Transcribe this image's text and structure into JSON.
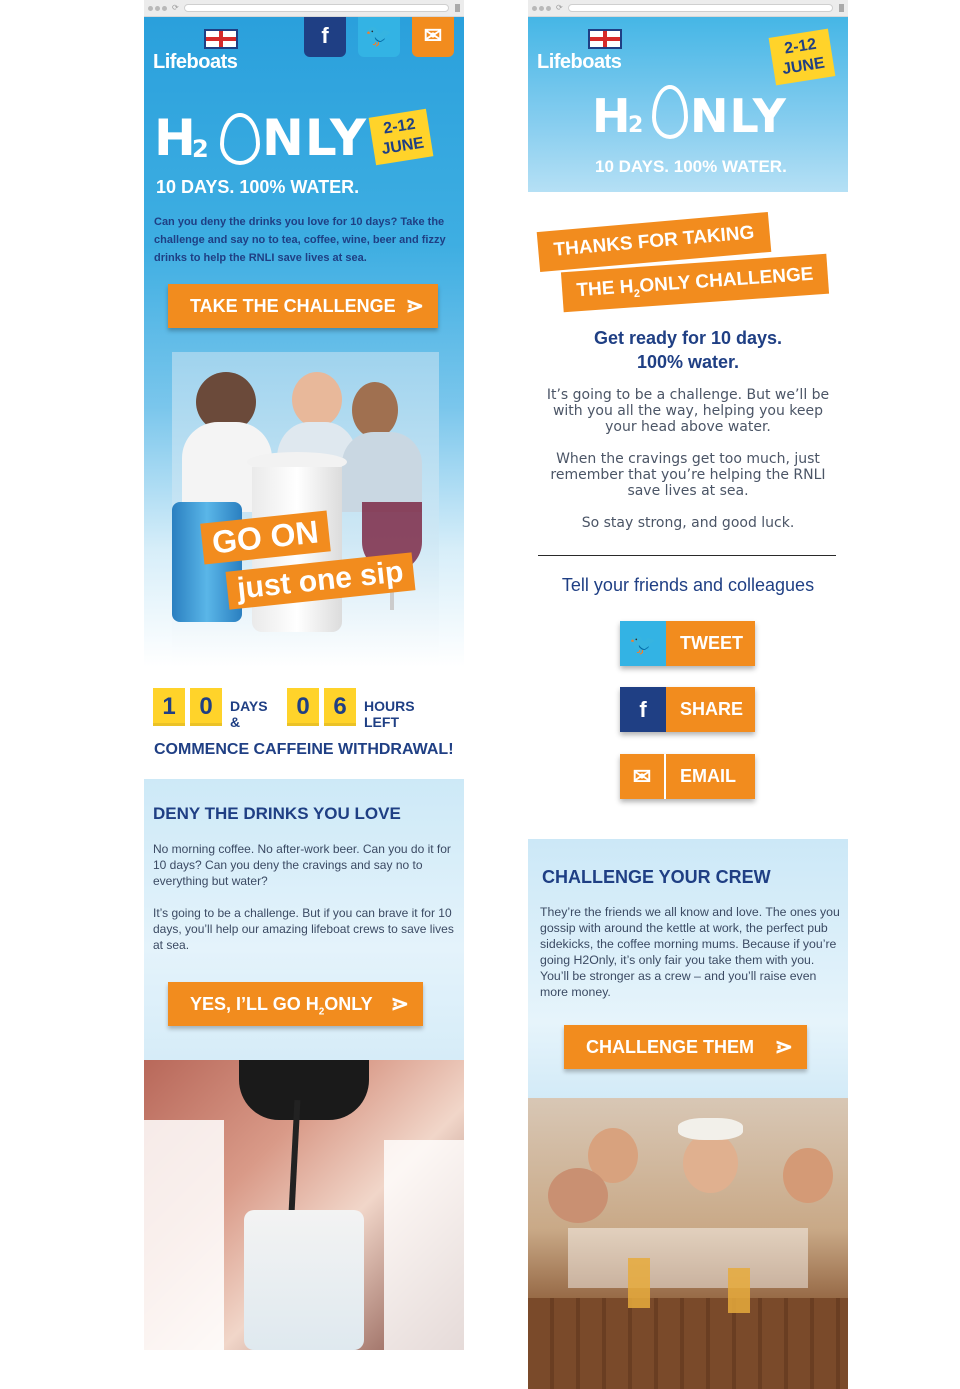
{
  "brand": {
    "name": "Lifeboats"
  },
  "campaign": {
    "title_h": "H",
    "title_2": "2",
    "title_rest": "NLY",
    "date_line1": "2-12",
    "date_line2": "JUNE",
    "tagline": "10 DAYS. 100% WATER."
  },
  "left": {
    "social": {
      "facebook": "f",
      "twitter": "t",
      "email": "✉"
    },
    "intro": "Can you deny the drinks you love for 10 days? Take the challenge and say no to tea, coffee, wine, beer and fizzy drinks to help the RNLI save lives at sea.",
    "cta_label": "TAKE THE CHALLENGE",
    "hero_caption_1": "GO ON",
    "hero_caption_2": "just one sip",
    "countdown": {
      "days_d1": "1",
      "days_d2": "0",
      "days_label": "DAYS &",
      "hours_d1": "0",
      "hours_d2": "6",
      "hours_label": "HOURS LEFT"
    },
    "withdrawal": "COMMENCE CAFFEINE WITHDRAWAL!",
    "deny": {
      "title": "DENY THE DRINKS YOU LOVE",
      "para1": "No morning coffee. No after-work beer. Can you do it for 10 days? Can you deny the cravings and say no to everything but water?",
      "para2": "It’s going to be a challenge. But if you can brave it for 10 days, you’ll help our amazing lifeboat crews to save lives at sea.",
      "cta_part1": "YES, I’LL GO H",
      "cta_sub": "2",
      "cta_part2": "ONLY"
    }
  },
  "right": {
    "thanks_line1": "THANKS FOR TAKING",
    "thanks_line2_a": "THE H",
    "thanks_line2_sub": "2",
    "thanks_line2_b": "ONLY CHALLENGE",
    "ready_line1": "Get ready for 10 days.",
    "ready_line2": "100% water.",
    "para1": "It’s going to be a challenge. But we’ll be with you all the way, helping you keep your head above water.",
    "para2": "When the cravings get too much, just remember that you’re helping the RNLI save lives at sea.",
    "para3": "So stay strong, and good luck.",
    "tell": "Tell your friends and colleagues",
    "tweet_label": "TWEET",
    "share_label": "SHARE",
    "email_label": "EMAIL",
    "crew": {
      "title": "CHALLENGE YOUR CREW",
      "body": "They’re the friends we all know and love. The ones you gossip with around the kettle at work, the perfect pub sidekicks, the coffee morning mums. Because if you’re going H2Only, it’s only fair you take them with you. You’ll be stronger as a crew – and you’ll raise even more money.",
      "cta_label": "CHALLENGE THEM"
    }
  },
  "colors": {
    "orange": "#f28c1e",
    "navy": "#1f3f84",
    "sky": "#33b3e4",
    "yellow": "#ffd32a"
  }
}
